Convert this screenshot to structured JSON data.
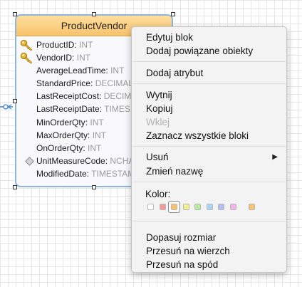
{
  "entity": {
    "title": "ProductVendor",
    "header_color": "#f8c36c",
    "border_color": "#8fb4dd",
    "attributes": [
      {
        "name": "ProductID",
        "type": "INT",
        "marker": "key-icon"
      },
      {
        "name": "VendorID",
        "type": "INT",
        "marker": "key-icon"
      },
      {
        "name": "AverageLeadTime",
        "type": "INT",
        "marker": ""
      },
      {
        "name": "StandardPrice",
        "type": "DECIMAL",
        "marker": ""
      },
      {
        "name": "LastReceiptCost",
        "type": "DECIM",
        "marker": ""
      },
      {
        "name": "LastReceiptDate",
        "type": "TIMES",
        "marker": ""
      },
      {
        "name": "MinOrderQty",
        "type": "INT",
        "marker": ""
      },
      {
        "name": "MaxOrderQty",
        "type": "INT",
        "marker": ""
      },
      {
        "name": "OnOrderQty",
        "type": "INT",
        "marker": ""
      },
      {
        "name": "UnitMeasureCode",
        "type": "NCHA",
        "marker": "diamond-icon"
      },
      {
        "name": "ModifiedDate",
        "type": "TIMESTAM",
        "marker": ""
      }
    ]
  },
  "menu": {
    "items": {
      "edit_block": "Edytuj blok",
      "add_related": "Dodaj powiązane obiekty",
      "add_attribute": "Dodaj atrybut",
      "cut": "Wytnij",
      "copy": "Kopiuj",
      "paste": "Wklej",
      "select_all": "Zaznacz wszystkie bloki",
      "delete": "Usuń",
      "rename": "Zmień nazwę",
      "fit_size": "Dopasuj rozmiar",
      "bring_front": "Przesuń na wierzch",
      "send_back": "Przesuń na spód"
    },
    "color_label": "Kolor:",
    "submenu_arrow": "▶",
    "colors": [
      "#ffffff",
      "#f29a9a",
      "#f8c36c",
      "#f6ef8e",
      "#b7eb9b",
      "#a9d6f7",
      "#b5bdf3",
      "#f6b3ea",
      "#f8c36c"
    ],
    "selected_color": "#f8c36c"
  }
}
